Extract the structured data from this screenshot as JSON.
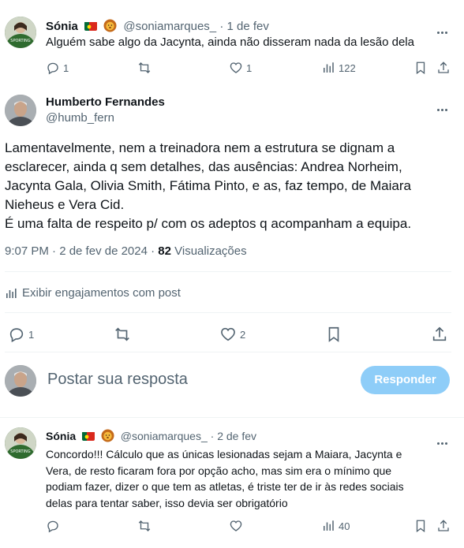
{
  "tweet1": {
    "name": "Sónia",
    "handle": "@soniamarques_",
    "sep": "·",
    "date": "1 de fev",
    "text": "Alguém sabe algo da Jacynta, ainda não disseram nada da lesão dela",
    "replies": "1",
    "retweets": "",
    "likes": "1",
    "views": "122"
  },
  "main": {
    "name": "Humberto Fernandes",
    "handle": "@humb_fern",
    "text_lines": [
      "Lamentavelmente, nem a treinadora nem a estrutura se dignam a",
      "esclarecer, ainda q sem detalhes, das ausências: Andrea Norheim,",
      "Jacynta Gala, Olivia Smith, Fátima Pinto, e as, faz tempo, de Maiara",
      "Nieheus e Vera Cid.",
      "É uma falta de respeito p/ com os adeptos q acompanham a equipa."
    ],
    "time": "9:07 PM · 2 de fev de 2024 · ",
    "views_count": "82",
    "views_label": " Visualizações",
    "engagements": "Exibir engajamentos com post",
    "replies": "1",
    "likes": "2"
  },
  "reply_box": {
    "placeholder": "Postar sua resposta",
    "button": "Responder"
  },
  "tweet2": {
    "name": "Sónia",
    "handle": "@soniamarques_",
    "sep": "·",
    "date": "2 de fev",
    "text_lines": [
      "Concordo!!! Cálculo que as únicas lesionadas sejam a Maiara, Jacynta e",
      "Vera, de resto ficaram fora por opção acho, mas sim era o mínimo que",
      "podiam fazer, dizer o que tem as atletas, é triste ter de ir às redes sociais",
      "delas para tentar saber, isso devia ser obrigatório"
    ],
    "views": "40"
  },
  "colors": {
    "accent": "#1d9bf0",
    "button_disabled": "#8ecdf8",
    "muted": "#536471",
    "border": "#eff3f4"
  }
}
